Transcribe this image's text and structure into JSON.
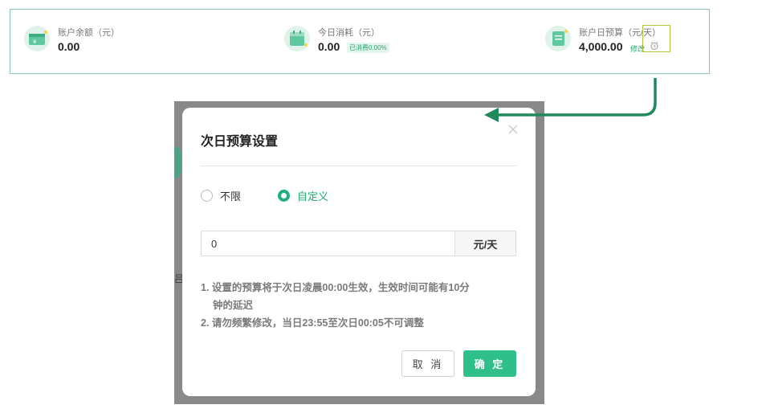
{
  "stats": {
    "balance": {
      "label": "账户余额（元）",
      "value": "0.00"
    },
    "today": {
      "label": "今日消耗（元）",
      "value": "0.00",
      "badge": "已消费0.00%"
    },
    "budget": {
      "label": "账户日预算（元/天）",
      "value": "4,000.00",
      "edit_label": "修改"
    }
  },
  "dialog": {
    "title": "次日预算设置",
    "options": [
      {
        "label": "不限",
        "selected": false
      },
      {
        "label": "自定义",
        "selected": true
      }
    ],
    "input": {
      "value": "0",
      "unit": "元/天"
    },
    "notes": {
      "line1a": "1. 设置的预算将于次日凌晨00:00生效，生效时间可能有10分",
      "line1b": "钟的延迟",
      "line2": "2. 请勿频繁修改，当日23:55至次日00:05不可调整"
    },
    "cancel_label": "取 消",
    "confirm_label": "确 定"
  },
  "colors": {
    "accent": "#2fbf8a",
    "arrow": "#1e8a5c",
    "highlight": "#a8c93a"
  },
  "icons": [
    "wallet-icon",
    "calendar-icon",
    "budget-book-icon",
    "alarm-clock-icon",
    "close-icon"
  ]
}
